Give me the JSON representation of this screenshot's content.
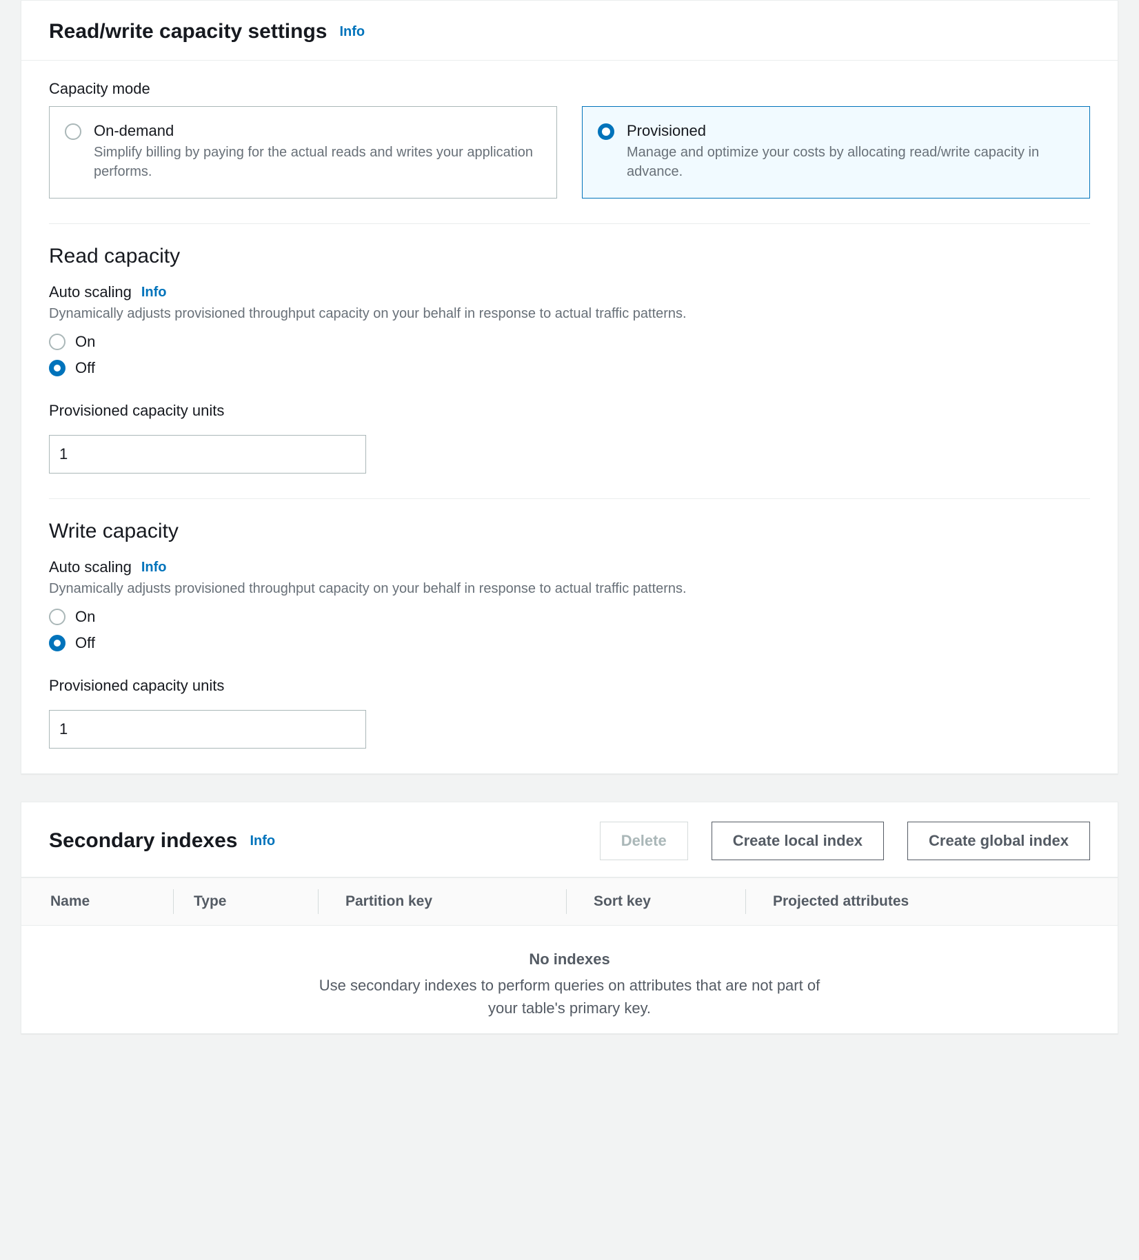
{
  "rw": {
    "title": "Read/write capacity settings",
    "info": "Info",
    "capacity_mode_label": "Capacity mode",
    "options": {
      "ondemand": {
        "title": "On-demand",
        "desc": "Simplify billing by paying for the actual reads and writes your application performs."
      },
      "provisioned": {
        "title": "Provisioned",
        "desc": "Manage and optimize your costs by allocating read/write capacity in advance."
      }
    },
    "read": {
      "heading": "Read capacity",
      "auto_label": "Auto scaling",
      "info": "Info",
      "helper": "Dynamically adjusts provisioned throughput capacity on your behalf in response to actual traffic patterns.",
      "on": "On",
      "off": "Off",
      "units_label": "Provisioned capacity units",
      "units_value": "1"
    },
    "write": {
      "heading": "Write capacity",
      "auto_label": "Auto scaling",
      "info": "Info",
      "helper": "Dynamically adjusts provisioned throughput capacity on your behalf in response to actual traffic patterns.",
      "on": "On",
      "off": "Off",
      "units_label": "Provisioned capacity units",
      "units_value": "1"
    }
  },
  "si": {
    "title": "Secondary indexes",
    "info": "Info",
    "delete": "Delete",
    "create_local": "Create local index",
    "create_global": "Create global index",
    "columns": {
      "name": "Name",
      "type": "Type",
      "pkey": "Partition key",
      "skey": "Sort key",
      "proj": "Projected attributes"
    },
    "empty": {
      "title": "No indexes",
      "desc": "Use secondary indexes to perform queries on attributes that are not part of your table's primary key."
    }
  }
}
